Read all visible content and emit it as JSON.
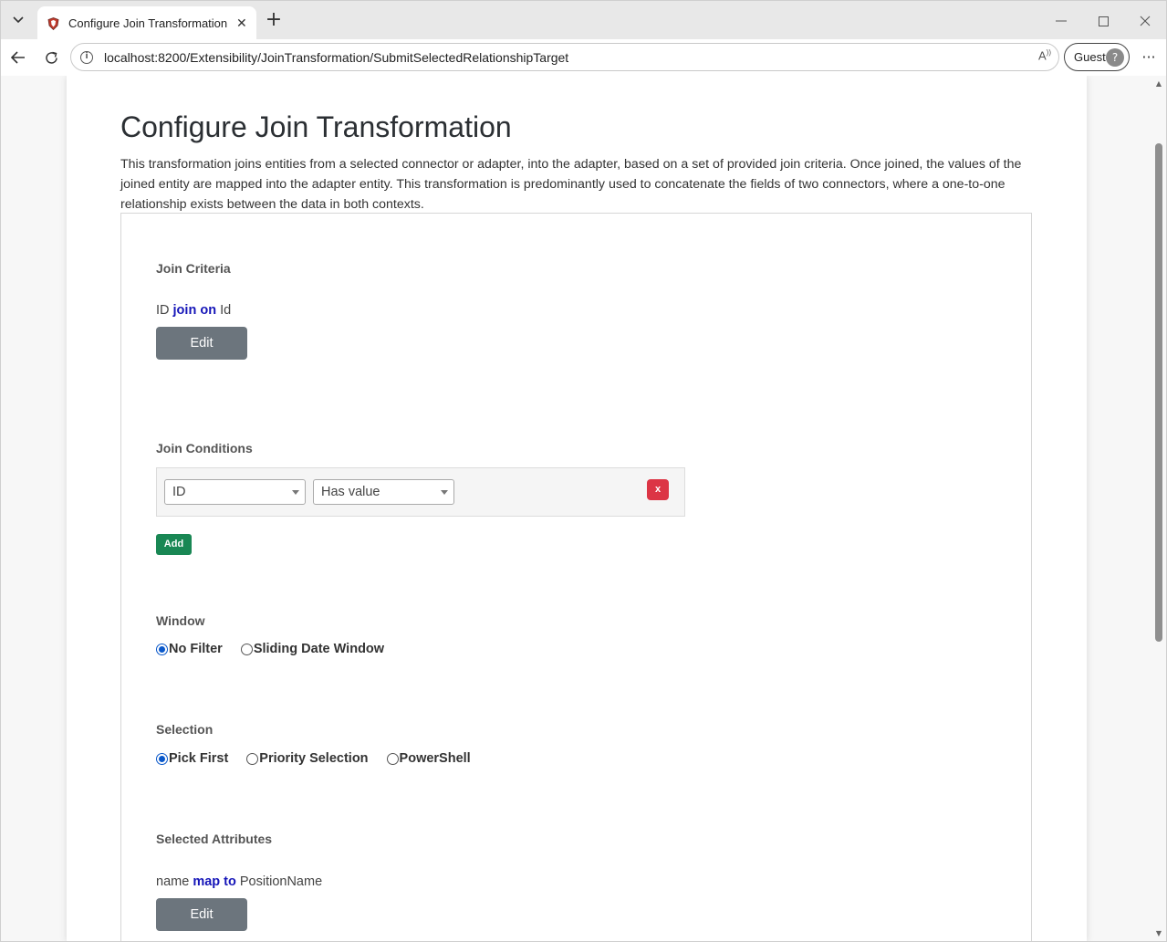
{
  "browser": {
    "tab_title": "Configure Join Transformation - UI",
    "tab_close": "✕",
    "new_tab": "+",
    "url": "localhost:8200/Extensibility/JoinTransformation/SubmitSelectedRelationshipTarget",
    "profile_label": "Guest",
    "more_label": "···"
  },
  "page": {
    "title": "Configure Join Transformation",
    "description": "This transformation joins entities from a selected connector or adapter, into the adapter, based on a set of provided join criteria. Once joined, the values of the joined entity are mapped into the adapter entity. This transformation is predominantly used to concatenate the fields of two connectors, where a one-to-one relationship exists between the data in both contexts."
  },
  "join_criteria": {
    "label": "Join Criteria",
    "source": "ID",
    "keyword": "join on",
    "target": "Id",
    "edit_label": "Edit"
  },
  "join_conditions": {
    "label": "Join Conditions",
    "rows": [
      {
        "field": "ID",
        "operator": "Has value",
        "remove_label": "x"
      }
    ],
    "add_label": "Add"
  },
  "window": {
    "label": "Window",
    "options": [
      {
        "label": "No Filter",
        "checked": true
      },
      {
        "label": "Sliding Date Window",
        "checked": false
      }
    ]
  },
  "selection": {
    "label": "Selection",
    "options": [
      {
        "label": "Pick First",
        "checked": true
      },
      {
        "label": "Priority Selection",
        "checked": false
      },
      {
        "label": "PowerShell",
        "checked": false
      }
    ]
  },
  "selected_attributes": {
    "label": "Selected Attributes",
    "source": "name",
    "keyword": "map to",
    "target": "PositionName",
    "edit_label": "Edit"
  },
  "colors": {
    "keyword": "#1515b8",
    "edit_button": "#6c757d",
    "remove_button": "#dc3545",
    "add_button": "#198754",
    "radio_checked": "#0a58ca"
  }
}
